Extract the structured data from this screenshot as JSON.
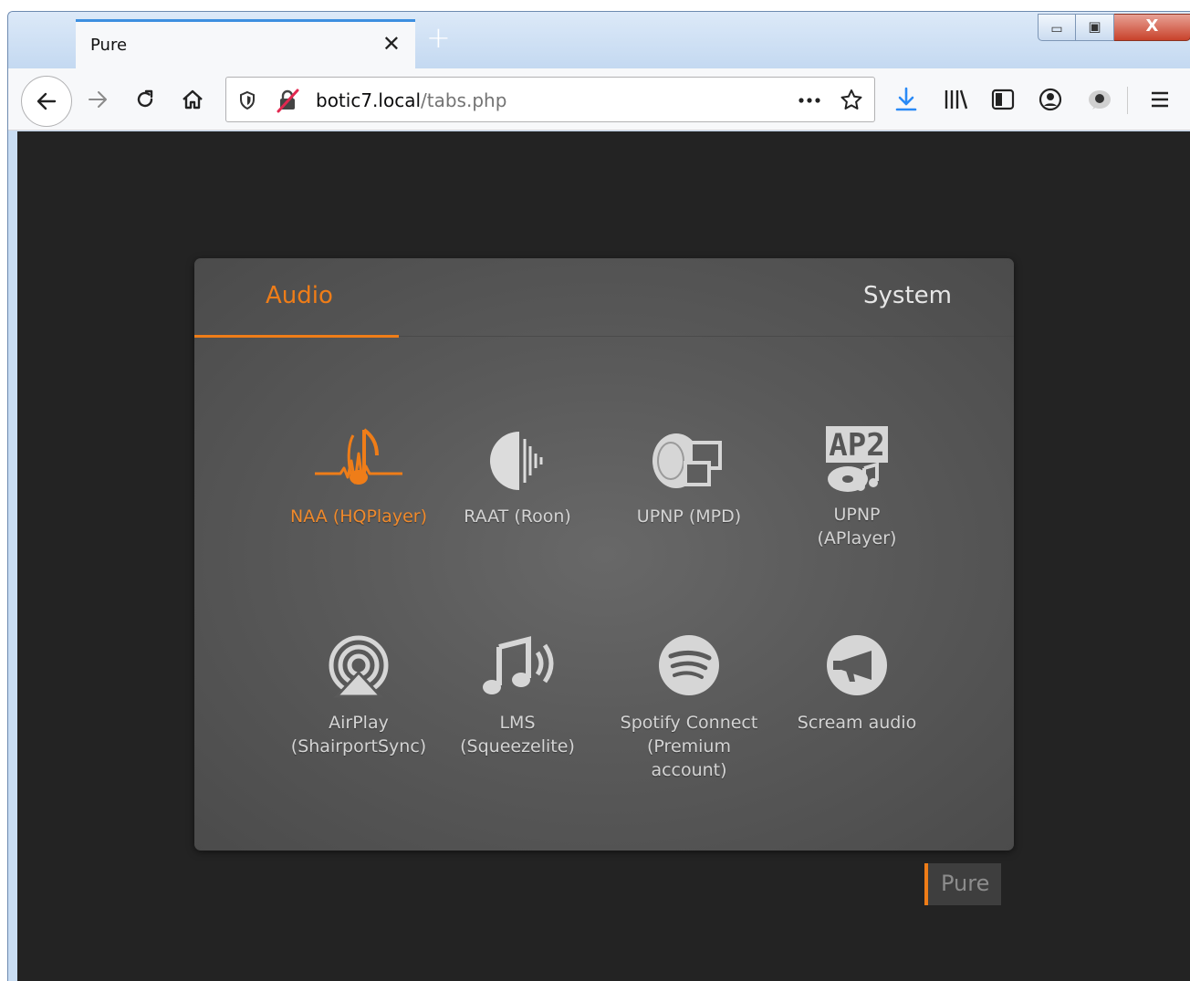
{
  "browser": {
    "tab_title": "Pure",
    "tab_close": "✕",
    "new_tab": "+",
    "url_host": "botic7.local",
    "url_path": "/tabs.php",
    "window_controls": {
      "minimize": "▭",
      "maximize": "▣",
      "close": "X"
    },
    "icons": [
      "back-icon",
      "forward-icon",
      "reload-icon",
      "home-icon",
      "shield-icon",
      "insecure-lock-icon",
      "more-icon",
      "star-icon",
      "download-icon",
      "library-icon",
      "sidebar-icon",
      "account-icon",
      "extension-icon",
      "menu-icon"
    ]
  },
  "panel": {
    "tabs": [
      {
        "label": "Audio",
        "active": true
      },
      {
        "label": "System",
        "active": false
      }
    ],
    "items": [
      {
        "label1": "NAA (HQPlayer)",
        "label2": "",
        "icon": "hqplayer-icon",
        "active": true
      },
      {
        "label1": "RAAT (Roon)",
        "label2": "",
        "icon": "roon-icon",
        "active": false
      },
      {
        "label1": "UPNP (MPD)",
        "label2": "",
        "icon": "upnp-mpd-icon",
        "active": false
      },
      {
        "label1": "UPNP",
        "label2": "(APlayer)",
        "icon": "ap2-icon",
        "icon_text": "AP2",
        "active": false
      },
      {
        "label1": "AirPlay",
        "label2": "(ShairportSync)",
        "icon": "airplay-icon",
        "active": false
      },
      {
        "label1": "LMS",
        "label2": "(Squeezelite)",
        "icon": "lms-icon",
        "active": false
      },
      {
        "label1": "Spotify Connect",
        "label2": "(Premium account)",
        "icon": "spotify-icon",
        "active": false
      },
      {
        "label1": "Scream audio",
        "label2": "",
        "icon": "scream-icon",
        "active": false
      }
    ]
  },
  "brand": {
    "label": "Pure",
    "accent": "#ef7d18"
  },
  "colors": {
    "accent": "#ef7d18",
    "panel": "#5a5a5a",
    "background": "#232323",
    "label": "#d4d4d4"
  }
}
